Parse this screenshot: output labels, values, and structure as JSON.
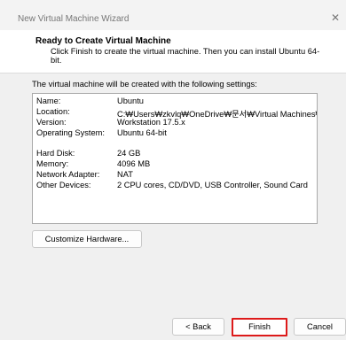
{
  "window": {
    "title": "New Virtual Machine Wizard",
    "close_glyph": "✕"
  },
  "header": {
    "title": "Ready to Create Virtual Machine",
    "subtitle": "Click Finish to create the virtual machine. Then you can install Ubuntu 64-bit."
  },
  "intro": "The virtual machine will be created with the following settings:",
  "settings": [
    {
      "key": "Name:",
      "value": "Ubuntu"
    },
    {
      "key": "Location:",
      "value": "C:₩Users₩zkvlq₩OneDrive₩문서₩Virtual Machines₩Ubu..."
    },
    {
      "key": "Version:",
      "value": "Workstation 17.5.x"
    },
    {
      "key": "Operating System:",
      "value": "Ubuntu 64-bit"
    },
    {
      "key": "Hard Disk:",
      "value": "24 GB"
    },
    {
      "key": "Memory:",
      "value": "4096 MB"
    },
    {
      "key": "Network Adapter:",
      "value": "NAT"
    },
    {
      "key": "Other Devices:",
      "value": "2 CPU cores, CD/DVD, USB Controller, Sound Card"
    }
  ],
  "buttons": {
    "customize": "Customize Hardware...",
    "back": "< Back",
    "finish": "Finish",
    "cancel": "Cancel"
  },
  "colors": {
    "finish_highlight": "#dd1a1a",
    "dialog_bg": "#f0f0f0"
  }
}
